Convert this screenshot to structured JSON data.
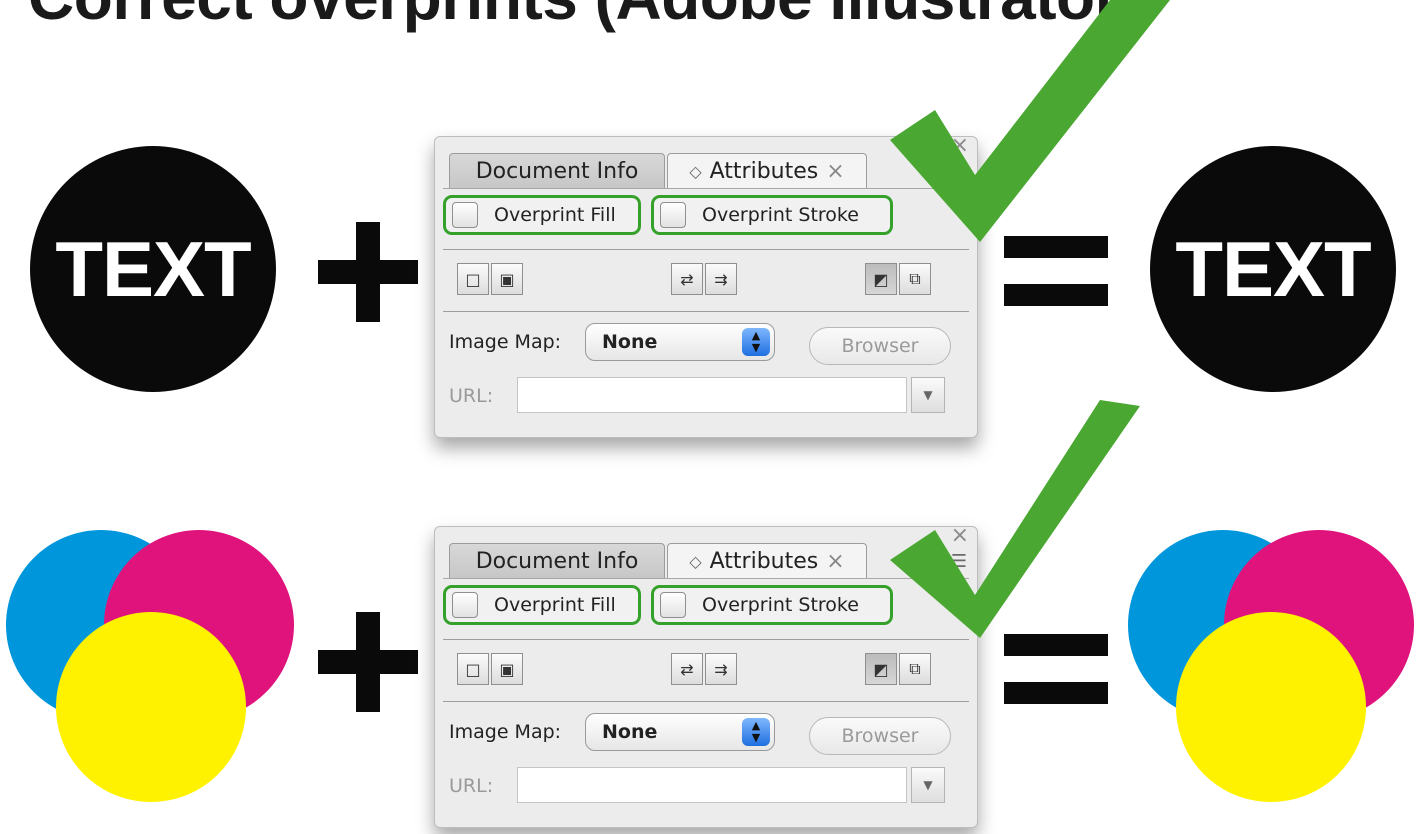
{
  "title": "Correct overprints (Adobe Illustrator)",
  "circle_text": "TEXT",
  "panel": {
    "tabs": {
      "inactive": "Document Info",
      "active": "Attributes"
    },
    "close_glyph": "×",
    "overprint_fill": {
      "label": "Overprint Fill",
      "checked": false
    },
    "overprint_stroke": {
      "label": "Overprint Stroke",
      "checked": false
    },
    "image_map": {
      "label": "Image Map:",
      "value": "None"
    },
    "browser_label": "Browser",
    "url_label": "URL:",
    "highlight_color": "#35a12b"
  },
  "icons": [
    "tab-stepper-icon",
    "tab-close-icon",
    "panel-menu-icon",
    "close-icon",
    "checkmark-icon",
    "plus-icon",
    "equals-icon"
  ],
  "colors": {
    "cyan": "#0096dc",
    "magenta": "#e0137c",
    "yellow": "#fff200",
    "check_green": "#4aa832",
    "black": "#0a0a0a"
  }
}
